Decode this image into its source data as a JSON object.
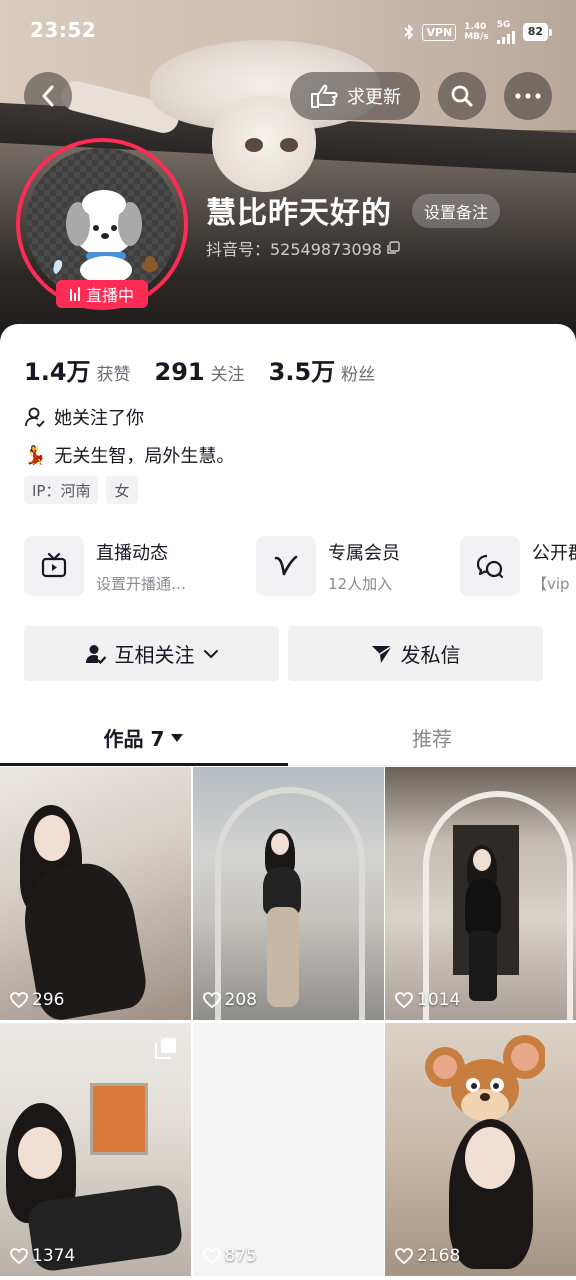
{
  "status_bar": {
    "time": "23:52",
    "vpn": "VPN",
    "speed_value": "1.40",
    "speed_unit": "MB/s",
    "network": "5G",
    "battery": "82"
  },
  "header": {
    "update_label": "求更新",
    "username": "慧比昨天好的",
    "remark_label": "设置备注",
    "douyin_id": "抖音号：52549873098",
    "live_label": "直播中"
  },
  "stats": [
    {
      "value": "1.4万",
      "label": "获赞"
    },
    {
      "value": "291",
      "label": "关注"
    },
    {
      "value": "3.5万",
      "label": "粉丝"
    }
  ],
  "profile": {
    "follows_you": "她关注了你",
    "bio_emoji": "💃",
    "bio": "无关生智，局外生慧。",
    "tags": [
      "IP：河南",
      "女"
    ]
  },
  "features": [
    {
      "title": "直播动态",
      "subtitle": "设置开播通…",
      "icon": "tv-icon"
    },
    {
      "title": "专属会员",
      "subtitle": "12人加入",
      "icon": "v-member-icon"
    },
    {
      "title": "公开群",
      "subtitle": "【vip",
      "icon": "group-chat-icon"
    }
  ],
  "actions": {
    "follow_label": "互相关注",
    "message_label": "发私信"
  },
  "tabs": {
    "works_label": "作品 7",
    "recommend_label": "推荐"
  },
  "videos": [
    {
      "likes": "296"
    },
    {
      "likes": "208"
    },
    {
      "likes": "1014"
    },
    {
      "likes": "1374",
      "multi": true
    },
    {
      "likes": "875"
    },
    {
      "likes": "2168"
    }
  ],
  "colors": {
    "accent": "#fe2c55",
    "text": "#161823",
    "muted": "#8a8b91",
    "button_bg": "#f1f1f2"
  }
}
